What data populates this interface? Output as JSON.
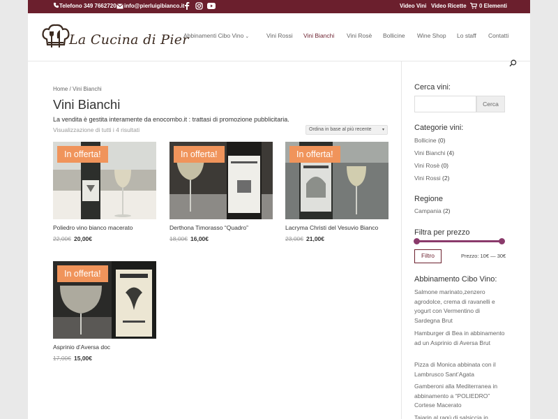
{
  "topbar": {
    "phone": "Telefono 349 7662720",
    "email": "info@pierluigibianco.it",
    "social_icons": [
      "facebook-icon",
      "instagram-icon",
      "youtube-icon"
    ],
    "links": [
      "Video Vini",
      "Video Ricette"
    ],
    "cart": "0 Elementi"
  },
  "header": {
    "logo_text": "La Cucina di Pier",
    "nav": [
      {
        "label": "Abbinamenti Cibo Vino",
        "has_dropdown": true,
        "active": false
      },
      {
        "label": "Vini Rossi",
        "active": false
      },
      {
        "label": "Vini Bianchi",
        "active": true
      },
      {
        "label": "Vini Rosè",
        "active": false
      },
      {
        "label": "Bollicine",
        "active": false
      },
      {
        "label": "Wine Shop",
        "active": false
      },
      {
        "label": "Lo staff",
        "active": false
      },
      {
        "label": "Contatti",
        "active": false
      }
    ]
  },
  "main": {
    "breadcrumb": "Home / Vini Bianchi",
    "title": "Vini Bianchi",
    "description": "La vendita è gestita interamente da enocombo.it : trattasi di promozione pubblicitaria.",
    "result_count": "Visualizzazione di tutti i 4 risultati",
    "sort_value": "Ordina in base al più recente",
    "products": [
      {
        "badge": "In offerta!",
        "name": "Poliedro vino bianco macerato",
        "old_price": "22,00€",
        "new_price": "20,00€"
      },
      {
        "badge": "In offerta!",
        "name": "Derthona Timorasso “Quadro”",
        "old_price": "18,00€",
        "new_price": "16,00€"
      },
      {
        "badge": "In offerta!",
        "name": "Lacryma Christi del Vesuvio Bianco",
        "old_price": "23,00€",
        "new_price": "21,00€"
      },
      {
        "badge": "In offerta!",
        "name": "Asprinio d’Aversa doc",
        "old_price": "17,00€",
        "new_price": "15,00€"
      }
    ]
  },
  "sidebar": {
    "search_title": "Cerca vini:",
    "search_placeholder": "",
    "search_button": "Cerca",
    "categories_title": "Categorie vini:",
    "categories": [
      {
        "name": "Bollicine",
        "count": "(0)"
      },
      {
        "name": "Vini Bianchi",
        "count": "(4)"
      },
      {
        "name": "Vini Rosè",
        "count": "(0)"
      },
      {
        "name": "Vini Rossi",
        "count": "(2)"
      }
    ],
    "region_title": "Regione",
    "regions": [
      {
        "name": "Campania",
        "count": "(2)"
      }
    ],
    "price_filter_title": "Filtra per prezzo",
    "filter_button": "Filtro",
    "price_range": "Prezzo: 10€ — 30€",
    "pairing_title": "Abbinamento Cibo Vino:",
    "pairings": [
      "Salmone marinato,zenzero agrodolce, crema di ravanelli e yogurt con Vermentino di Sardegna Brut",
      "Hamburger di Bea in abbinamento ad un Asprinio di Aversa Brut",
      "Pizza di Monica abbinata con il Lambrusco Sant’Agata",
      "Gamberoni alla Mediterranea in abbinamento a “POLIEDRO” Cortese Macerato",
      "Tajarin al ragù di salsiccia in"
    ]
  },
  "colors": {
    "brand": "#6b1f2d",
    "badge": "#f0945b",
    "slider": "#8a3a6b"
  }
}
